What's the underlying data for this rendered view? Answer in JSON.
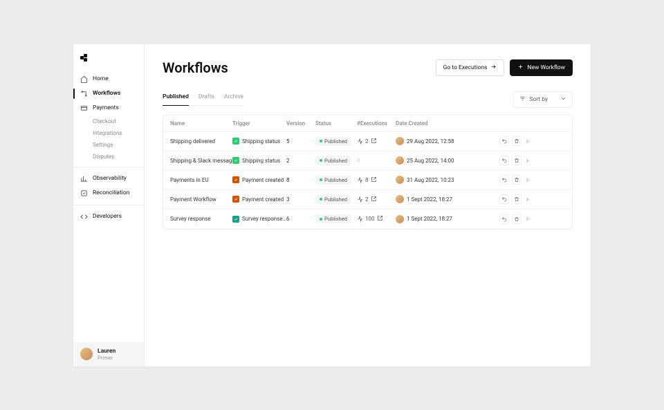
{
  "sidebar": {
    "items": [
      {
        "label": "Home"
      },
      {
        "label": "Workflows"
      },
      {
        "label": "Payments"
      },
      {
        "label": "Observability"
      },
      {
        "label": "Reconciliation"
      },
      {
        "label": "Developers"
      }
    ],
    "payments_sub": [
      {
        "label": "Checkout"
      },
      {
        "label": "Integrations"
      },
      {
        "label": "Settings"
      },
      {
        "label": "Disputes"
      }
    ]
  },
  "user": {
    "name": "Lauren",
    "org": "Primer"
  },
  "header": {
    "title": "Workflows",
    "go_executions": "Go to Executions",
    "new_workflow": "New Workflow"
  },
  "tabs": {
    "published": "Published",
    "drafts": "Drafts",
    "archive": "Archive"
  },
  "sort": {
    "label": "Sort by"
  },
  "table": {
    "headers": {
      "name": "Name",
      "trigger": "Trigger",
      "version": "Version",
      "status": "Status",
      "executions": "#Executions",
      "date": "Date Created"
    },
    "rows": [
      {
        "name": "Shipping delivered",
        "trigger": "Shipping status",
        "trigger_color": "tb-green",
        "version": "5",
        "status": "Published",
        "executions": "2",
        "has_exec": true,
        "date": "29 Aug 2022, 12:58"
      },
      {
        "name": "Shipping & Slack message",
        "trigger": "Shipping status",
        "trigger_color": "tb-green",
        "version": "2",
        "status": "Published",
        "executions": "0",
        "has_exec": false,
        "date": "25 Aug 2022, 14:00"
      },
      {
        "name": "Payments in EU",
        "trigger": "Payment created",
        "trigger_color": "tb-orange",
        "version": "8",
        "status": "Published",
        "executions": "8",
        "has_exec": true,
        "date": "31 Aug 2022, 10:23"
      },
      {
        "name": "Payment Workflow",
        "trigger": "Payment created",
        "trigger_color": "tb-orange",
        "version": "3",
        "status": "Published",
        "executions": "2",
        "has_exec": true,
        "date": "1 Sept 2022, 18:27"
      },
      {
        "name": "Survey response",
        "trigger": "Survey response...",
        "trigger_color": "tb-teal",
        "version": "6",
        "status": "Published",
        "executions": "100",
        "has_exec": true,
        "date": "1 Sept 2022, 18:27"
      }
    ]
  }
}
